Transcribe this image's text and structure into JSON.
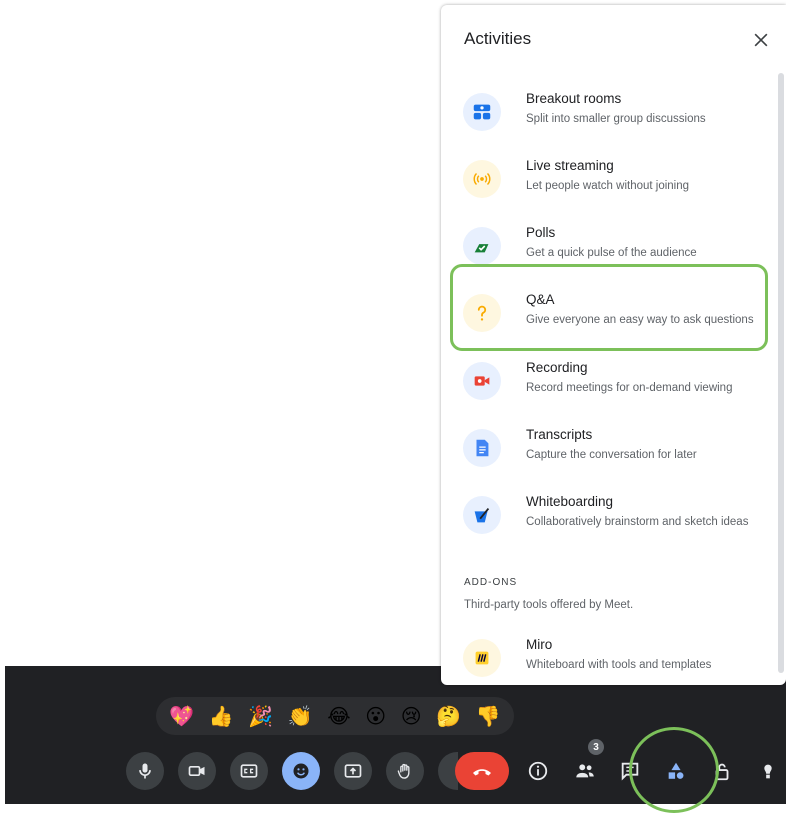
{
  "panel": {
    "title": "Activities",
    "items": [
      {
        "title": "Breakout rooms",
        "desc": "Split into smaller group discussions",
        "icon": "breakout-rooms-icon"
      },
      {
        "title": "Live streaming",
        "desc": "Let people watch without joining",
        "icon": "live-streaming-icon"
      },
      {
        "title": "Polls",
        "desc": "Get a quick pulse of the audience",
        "icon": "polls-icon"
      },
      {
        "title": "Q&A",
        "desc": "Give everyone an easy way to ask questions",
        "icon": "qa-icon"
      },
      {
        "title": "Recording",
        "desc": "Record meetings for on-demand viewing",
        "icon": "recording-icon"
      },
      {
        "title": "Transcripts",
        "desc": "Capture the conversation for later",
        "icon": "transcripts-icon"
      },
      {
        "title": "Whiteboarding",
        "desc": "Collaboratively brainstorm and sketch ideas",
        "icon": "whiteboarding-icon"
      }
    ],
    "addons_heading": "ADD-ONS",
    "addons_sub": "Third-party tools offered by Meet.",
    "addon": {
      "title": "Miro",
      "desc": "Whiteboard with tools and templates",
      "icon": "miro-icon"
    }
  },
  "reactions": [
    "💖",
    "👍",
    "🎉",
    "👏",
    "😂",
    "😮",
    "😢",
    "🤔",
    "👎"
  ],
  "people_count": "3",
  "colors": {
    "highlight": "#7cc05a",
    "leave": "#ea4335",
    "bar": "#202124",
    "active_control": "#8ab4f8"
  }
}
